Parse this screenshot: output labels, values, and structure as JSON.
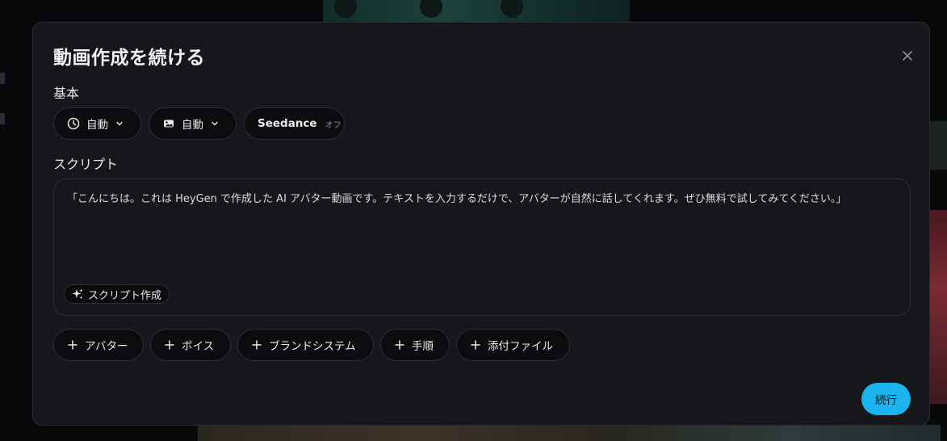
{
  "modal": {
    "title": "動画作成を続ける",
    "close_icon": "close-icon"
  },
  "basic": {
    "label": "基本",
    "duration": {
      "label": "自動",
      "icon": "clock-icon"
    },
    "aspect": {
      "label": "自動",
      "icon": "image-icon"
    },
    "model": {
      "label": "Seedance",
      "status": "オフ"
    }
  },
  "script": {
    "label": "スクリプト",
    "text": "「こんにちは。これは HeyGen で作成した AI アバター動画です。テキストを入力するだけで、アバターが自然に話してくれます。ぜひ無料で試してみてください。」",
    "generate_label": "スクリプト作成",
    "generate_icon": "sparkle-icon"
  },
  "add_buttons": [
    {
      "label": "アバター"
    },
    {
      "label": "ボイス"
    },
    {
      "label": "ブランドシステム"
    },
    {
      "label": "手順"
    },
    {
      "label": "添付ファイル"
    }
  ],
  "continue_label": "続行",
  "colors": {
    "accent": "#19b4ee",
    "modal_bg": "#16171a",
    "chip_bg": "#0b0c0e"
  }
}
